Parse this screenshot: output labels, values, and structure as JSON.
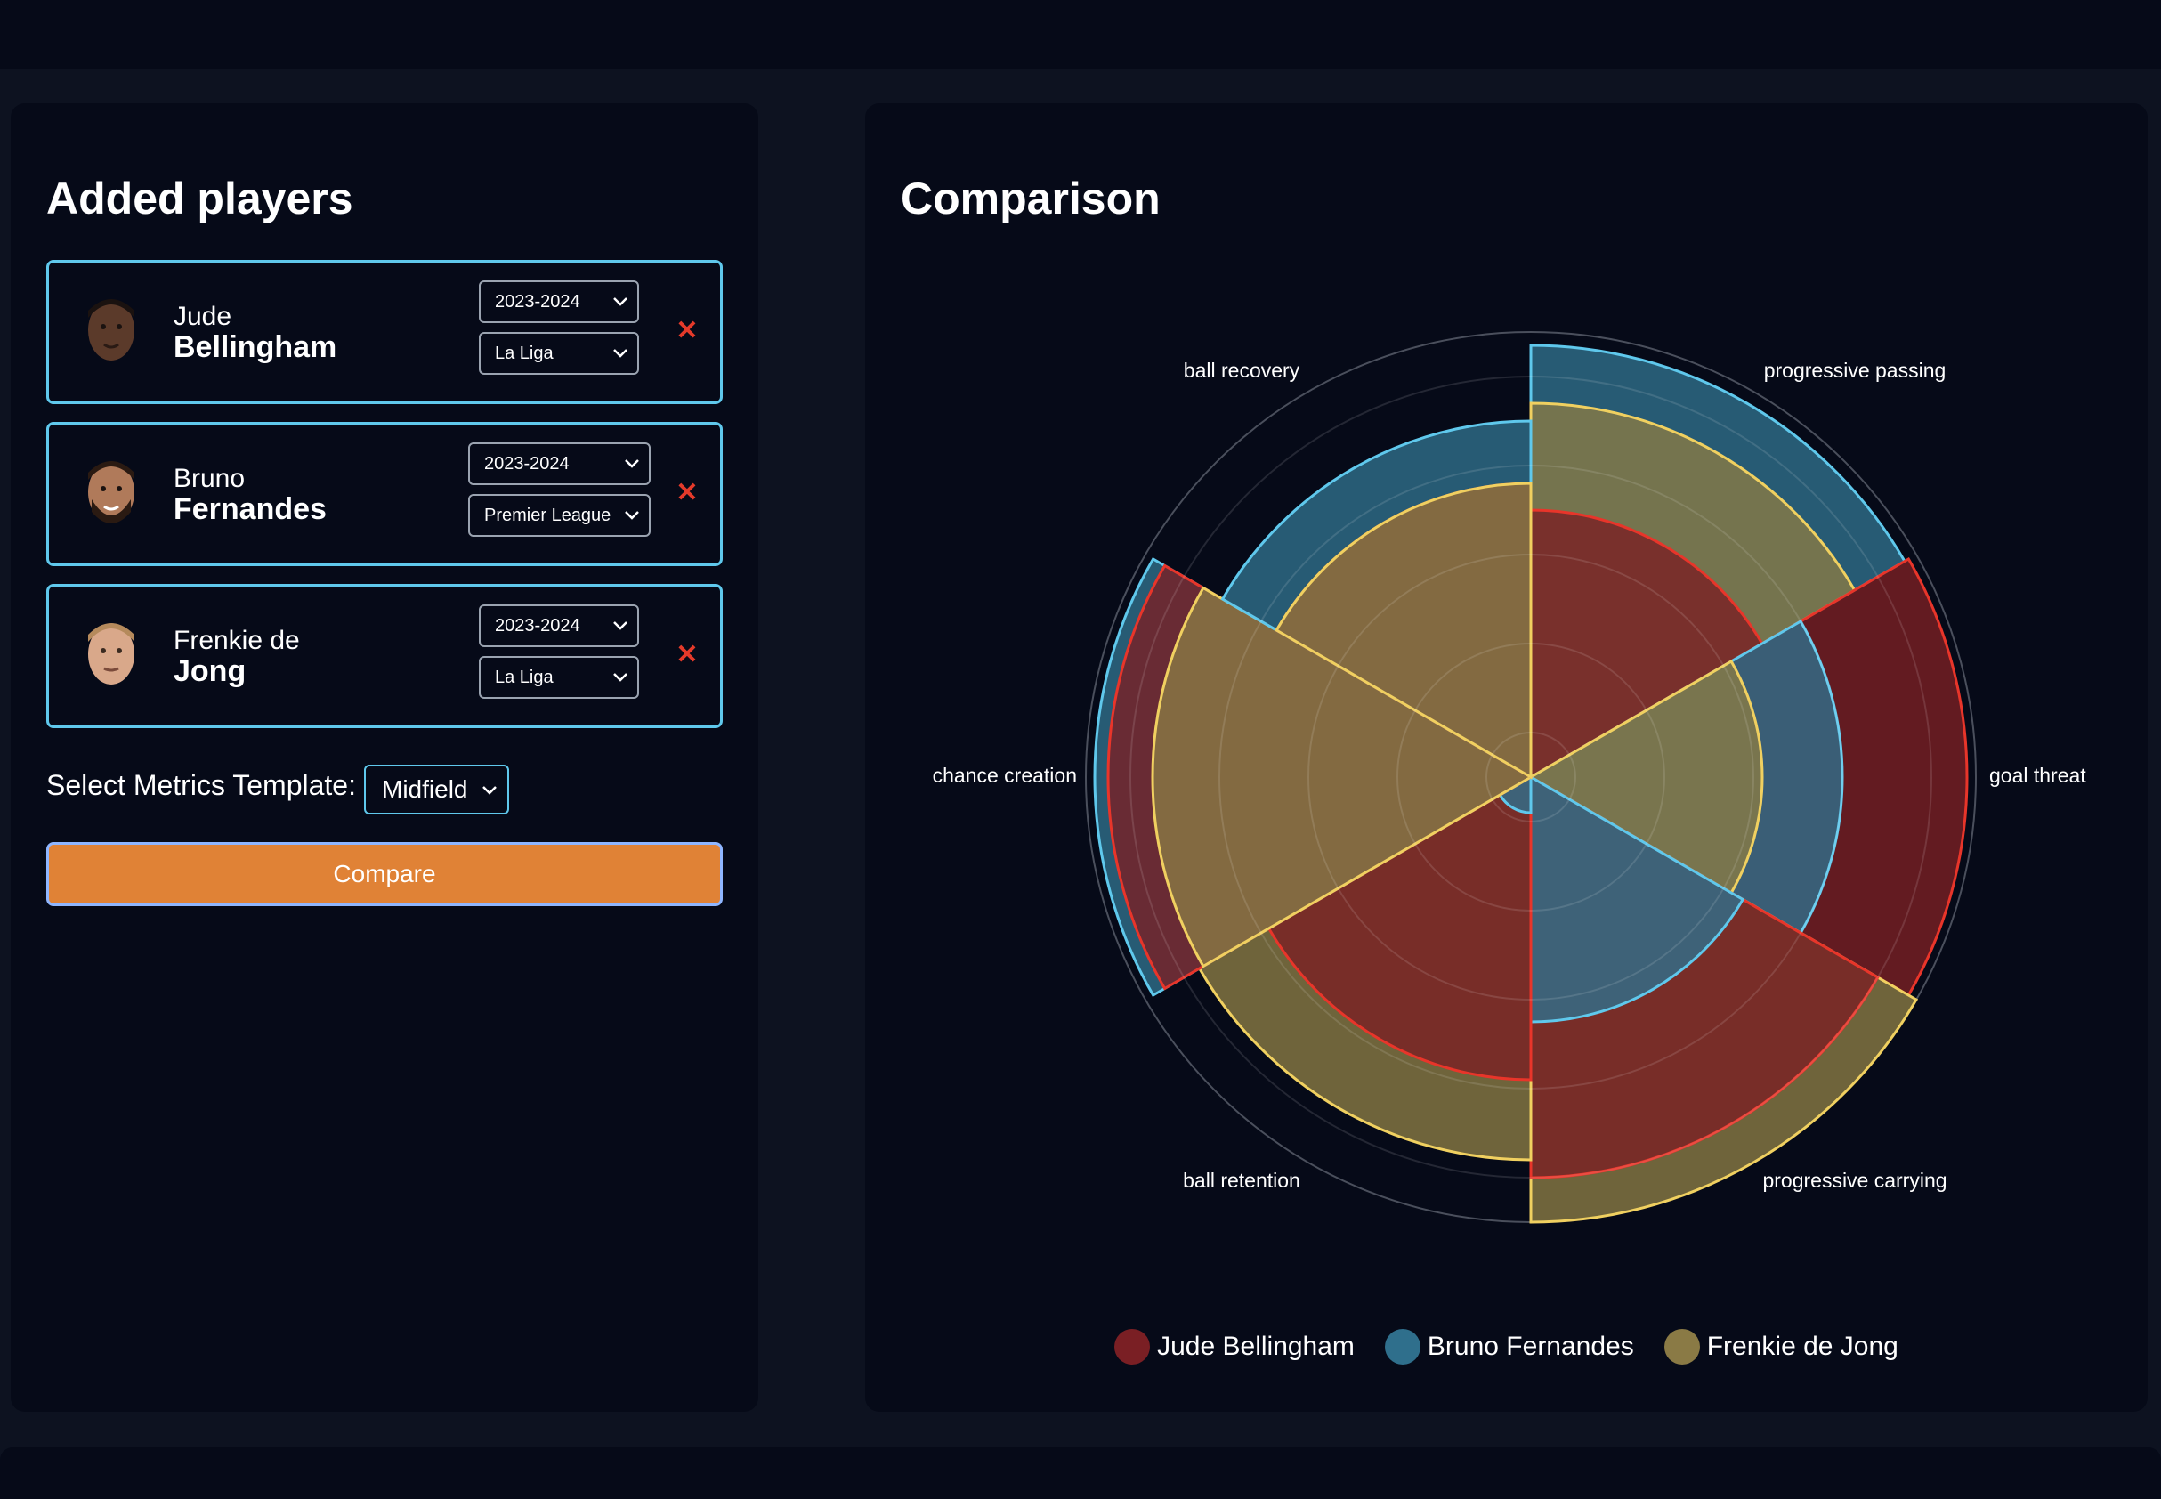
{
  "left_panel": {
    "title": "Added players",
    "players": [
      {
        "first": "Jude",
        "last": "Bellingham",
        "season": "2023-2024",
        "league": "La Liga"
      },
      {
        "first": "Bruno",
        "last": "Fernandes",
        "season": "2023-2024",
        "league": "Premier League"
      },
      {
        "first": "Frenkie de",
        "last": "Jong",
        "season": "2023-2024",
        "league": "La Liga"
      }
    ],
    "remove_icon": "close-icon",
    "template_label": "Select Metrics Template:",
    "template_value": "Midfield",
    "compare_label": "Compare"
  },
  "right_panel": {
    "title": "Comparison"
  },
  "chart_data": {
    "type": "polar-area",
    "title": "",
    "axes": [
      "progressive passing",
      "goal threat",
      "progressive carrying",
      "ball retention",
      "chance creation",
      "ball recovery"
    ],
    "rmax": 100,
    "series": [
      {
        "name": "Jude Bellingham",
        "color": "#e8352a",
        "fill": "#7a1f24",
        "values": [
          60,
          98,
          90,
          68,
          95,
          66
        ]
      },
      {
        "name": "Bruno Fernandes",
        "color": "#5fc8ec",
        "fill": "#2f6f8c",
        "values": [
          97,
          70,
          55,
          8,
          98,
          80
        ]
      },
      {
        "name": "Frenkie de Jong",
        "color": "#f0d060",
        "fill": "#8a7a45",
        "values": [
          84,
          52,
          100,
          86,
          85,
          66
        ]
      }
    ],
    "legend_position": "bottom-center",
    "grid": true
  }
}
